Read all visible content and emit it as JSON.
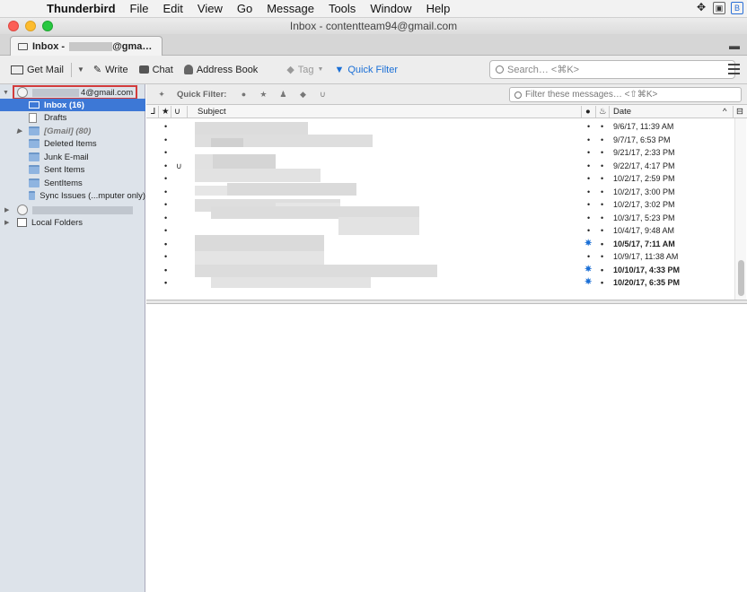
{
  "menubar": {
    "app": "Thunderbird",
    "items": [
      "File",
      "Edit",
      "View",
      "Go",
      "Message",
      "Tools",
      "Window",
      "Help"
    ]
  },
  "window": {
    "title": "Inbox - contentteam94@gmail.com"
  },
  "tab": {
    "label_prefix": "Inbox -",
    "label_suffix": "@gma…"
  },
  "toolbar": {
    "get_mail": "Get Mail",
    "write": "Write",
    "chat": "Chat",
    "address_book": "Address Book",
    "tag": "Tag",
    "quick_filter": "Quick Filter",
    "search_placeholder": "Search… <⌘K>"
  },
  "quick_filter_bar": {
    "label": "Quick Filter:",
    "filter_placeholder": "Filter these messages… <⇧⌘K>"
  },
  "folders": {
    "account_suffix": "4@gmail.com",
    "items": [
      {
        "label": "Inbox (16)"
      },
      {
        "label": "Drafts"
      },
      {
        "label": "[Gmail] (80)"
      },
      {
        "label": "Deleted Items"
      },
      {
        "label": "Junk E-mail"
      },
      {
        "label": "Sent Items"
      },
      {
        "label": "SentItems"
      },
      {
        "label": "Sync Issues (...mputer only)"
      }
    ],
    "local_folders": "Local Folders"
  },
  "columns": {
    "subject": "Subject",
    "date": "Date"
  },
  "messages": [
    {
      "date": "9/6/17, 11:39 AM",
      "unread": false
    },
    {
      "date": "9/7/17, 6:53 PM",
      "unread": false
    },
    {
      "date": "9/21/17, 2:33 PM",
      "unread": false
    },
    {
      "date": "9/22/17, 4:17 PM",
      "unread": false
    },
    {
      "date": "10/2/17, 2:59 PM",
      "unread": false
    },
    {
      "date": "10/2/17, 3:00 PM",
      "unread": false
    },
    {
      "date": "10/2/17, 3:02 PM",
      "unread": false
    },
    {
      "date": "10/3/17, 5:23 PM",
      "unread": false
    },
    {
      "date": "10/4/17, 9:48 AM",
      "unread": false
    },
    {
      "date": "10/5/17, 7:11 AM",
      "unread": true
    },
    {
      "date": "10/9/17, 11:38 AM",
      "unread": false
    },
    {
      "date": "10/10/17, 4:33 PM",
      "unread": true
    },
    {
      "date": "10/20/17, 6:35 PM",
      "unread": true
    }
  ]
}
